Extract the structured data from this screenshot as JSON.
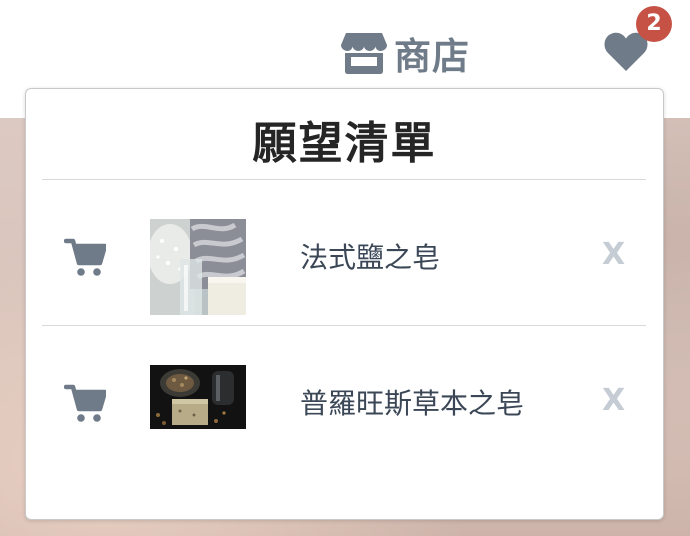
{
  "header": {
    "shop_label": "商店",
    "wishlist_count": "2",
    "icon_color": "#6f7b88",
    "badge_color": "#c65145"
  },
  "wishlist": {
    "title": "願望清單",
    "items": [
      {
        "name": "法式鹽之皂",
        "remove_label": "X",
        "thumb": "salt-soap-photo"
      },
      {
        "name": "普羅旺斯草本之皂",
        "remove_label": "X",
        "thumb": "herbal-soap-photo"
      }
    ]
  }
}
